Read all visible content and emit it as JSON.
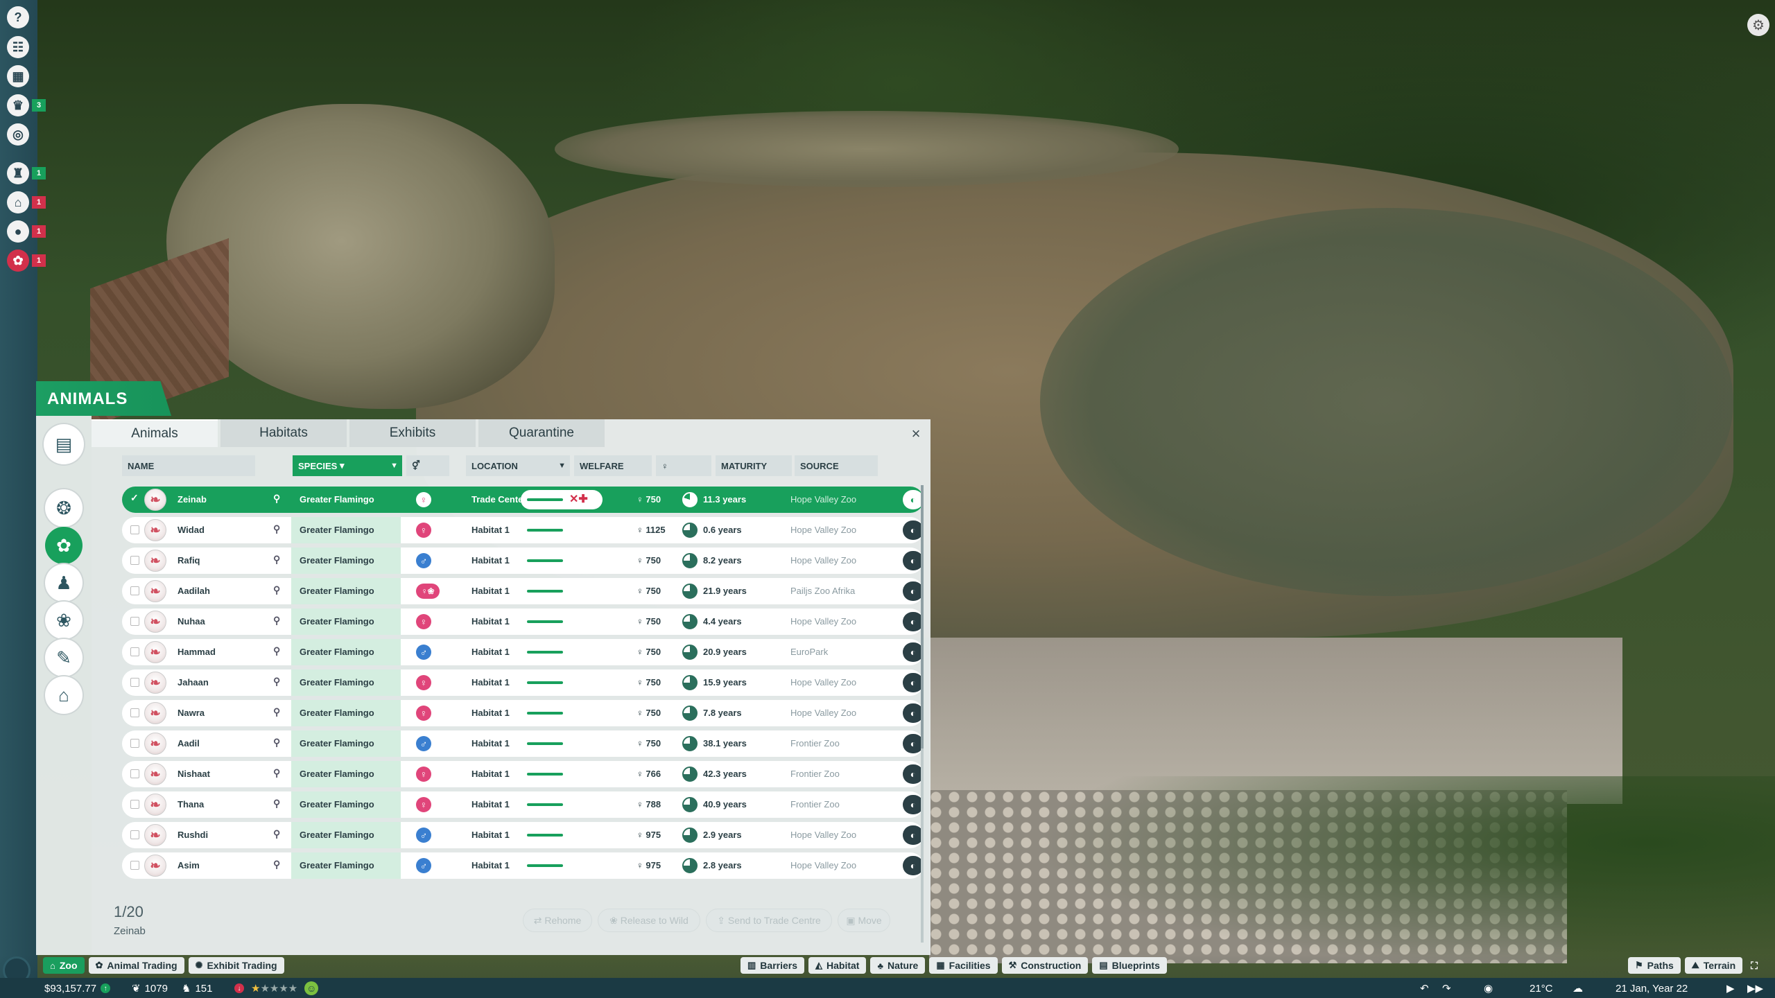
{
  "left_toolbar": {
    "badges": [
      "3",
      "1",
      "1",
      "1",
      "1"
    ]
  },
  "panel": {
    "title": "ANIMALS",
    "tabs": [
      "Animals",
      "Habitats",
      "Exhibits",
      "Quarantine"
    ],
    "close": "×",
    "columns": {
      "name": "NAME",
      "species": "SPECIES",
      "location": "LOCATION",
      "welfare": "WELFARE",
      "maturity": "MATURITY",
      "source": "SOURCE"
    },
    "animals": [
      {
        "name": "Zeinab",
        "species": "Greater Flamingo",
        "sex": "female",
        "location": "Trade Center",
        "cost": "750",
        "maturity": "11.3 years",
        "source": "Hope Valley Zoo",
        "selected": true
      },
      {
        "name": "Widad",
        "species": "Greater Flamingo",
        "sex": "female",
        "location": "Habitat 1",
        "cost": "1125",
        "maturity": "0.6 years",
        "source": "Hope Valley Zoo"
      },
      {
        "name": "Rafiq",
        "species": "Greater Flamingo",
        "sex": "male",
        "location": "Habitat 1",
        "cost": "750",
        "maturity": "8.2 years",
        "source": "Hope Valley Zoo"
      },
      {
        "name": "Aadilah",
        "species": "Greater Flamingo",
        "sex": "pregnant",
        "location": "Habitat 1",
        "cost": "750",
        "maturity": "21.9 years",
        "source": "Pailjs Zoo Afrika"
      },
      {
        "name": "Nuhaa",
        "species": "Greater Flamingo",
        "sex": "female",
        "location": "Habitat 1",
        "cost": "750",
        "maturity": "4.4 years",
        "source": "Hope Valley Zoo"
      },
      {
        "name": "Hammad",
        "species": "Greater Flamingo",
        "sex": "male",
        "location": "Habitat 1",
        "cost": "750",
        "maturity": "20.9 years",
        "source": "EuroPark"
      },
      {
        "name": "Jahaan",
        "species": "Greater Flamingo",
        "sex": "female",
        "location": "Habitat 1",
        "cost": "750",
        "maturity": "15.9 years",
        "source": "Hope Valley Zoo"
      },
      {
        "name": "Nawra",
        "species": "Greater Flamingo",
        "sex": "female",
        "location": "Habitat 1",
        "cost": "750",
        "maturity": "7.8 years",
        "source": "Hope Valley Zoo"
      },
      {
        "name": "Aadil",
        "species": "Greater Flamingo",
        "sex": "male",
        "location": "Habitat 1",
        "cost": "750",
        "maturity": "38.1 years",
        "source": "Frontier Zoo"
      },
      {
        "name": "Nishaat",
        "species": "Greater Flamingo",
        "sex": "female",
        "location": "Habitat 1",
        "cost": "766",
        "maturity": "42.3 years",
        "source": "Frontier Zoo"
      },
      {
        "name": "Thana",
        "species": "Greater Flamingo",
        "sex": "female",
        "location": "Habitat 1",
        "cost": "788",
        "maturity": "40.9 years",
        "source": "Frontier Zoo"
      },
      {
        "name": "Rushdi",
        "species": "Greater Flamingo",
        "sex": "male",
        "location": "Habitat 1",
        "cost": "975",
        "maturity": "2.9 years",
        "source": "Hope Valley Zoo"
      },
      {
        "name": "Asim",
        "species": "Greater Flamingo",
        "sex": "male",
        "location": "Habitat 1",
        "cost": "975",
        "maturity": "2.8 years",
        "source": "Hope Valley Zoo"
      }
    ],
    "counter": "1/20",
    "counter_sub": "Zeinab",
    "actions": [
      "Rehome",
      "Release to Wild",
      "Send to Trade Centre",
      "Move"
    ]
  },
  "bottom_left_tabs": [
    "Zoo",
    "Animal Trading",
    "Exhibit Trading"
  ],
  "bottom_center_tabs": [
    "Barriers",
    "Habitat",
    "Nature",
    "Facilities",
    "Construction",
    "Blueprints"
  ],
  "bottom_right_tabs": [
    "Paths",
    "Terrain"
  ],
  "status": {
    "money": "$93,157.77",
    "conservation": "1079",
    "guests": "151",
    "temperature": "21°C",
    "date": "21 Jan, Year 22"
  }
}
